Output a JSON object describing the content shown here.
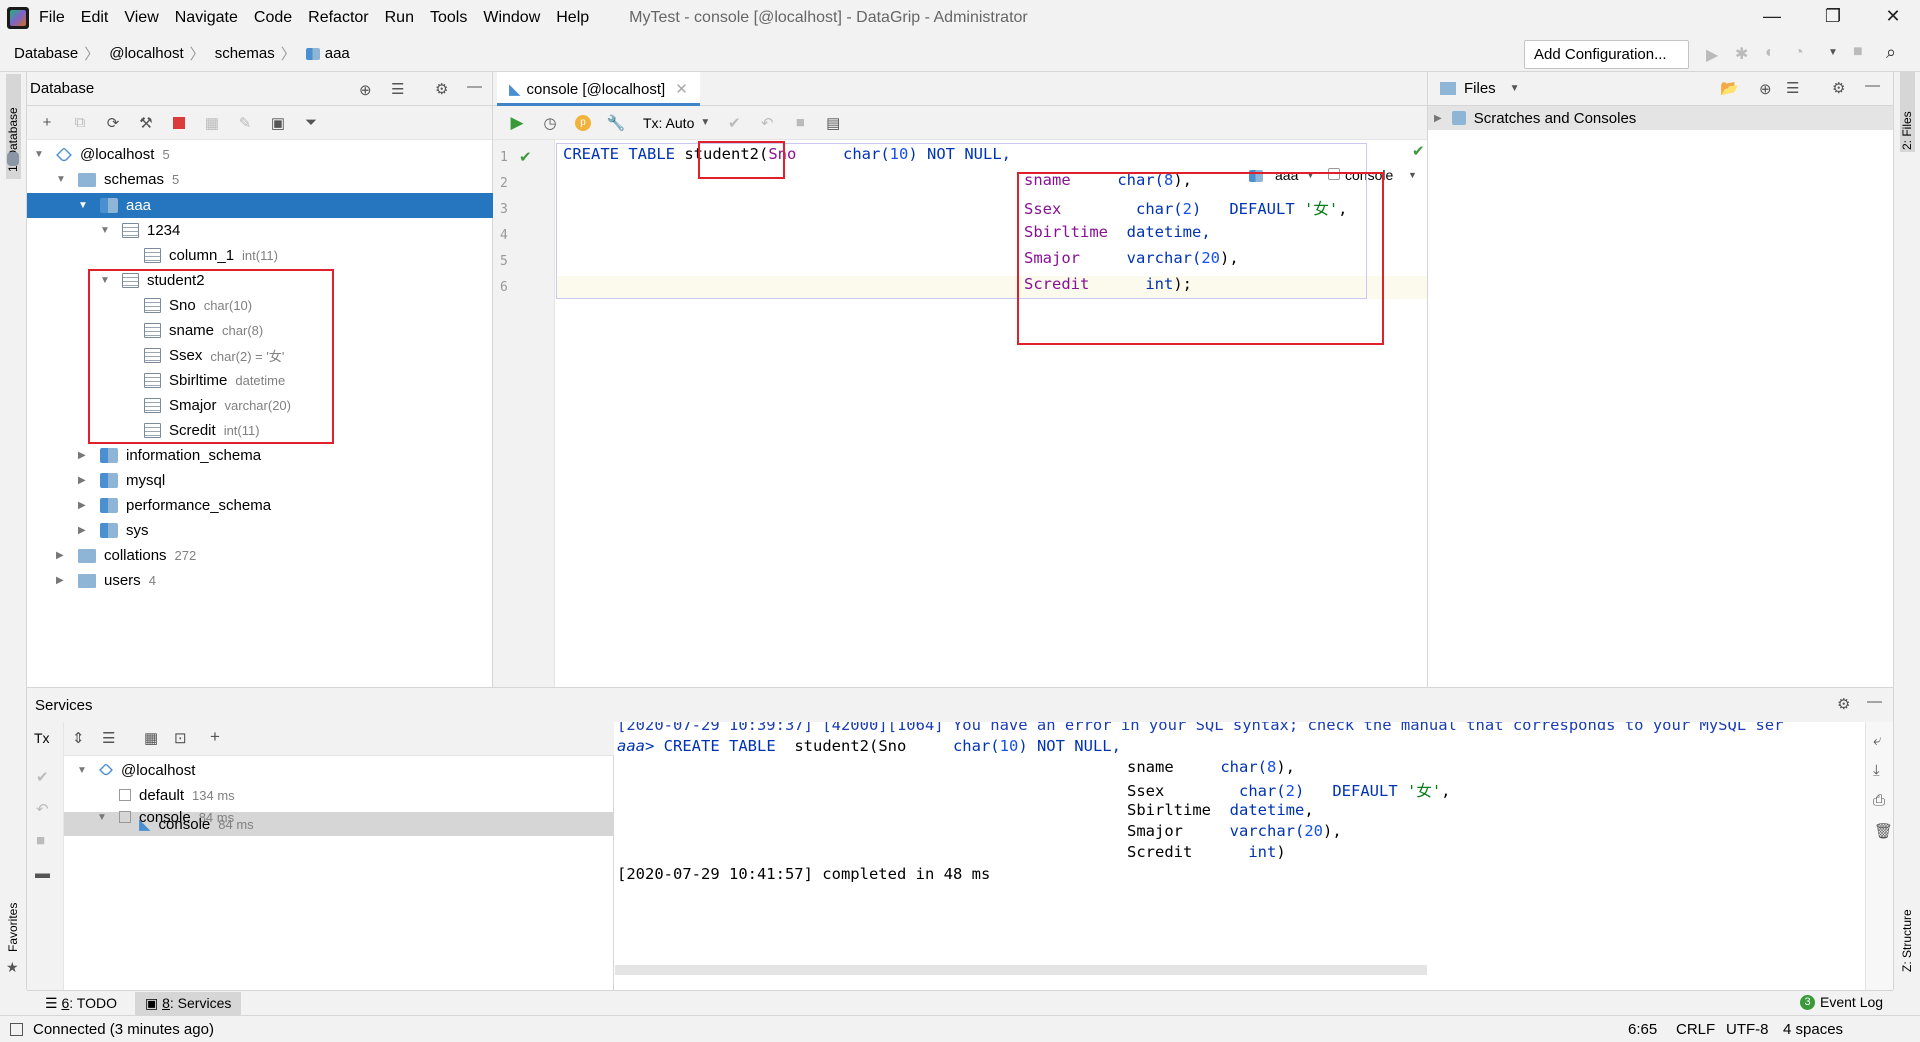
{
  "menu": {
    "items": [
      "File",
      "Edit",
      "View",
      "Navigate",
      "Code",
      "Refactor",
      "Run",
      "Tools",
      "Window",
      "Help"
    ],
    "title": "MyTest - console [@localhost] - DataGrip - Administrator"
  },
  "breadcrumb": [
    "Database",
    "@localhost",
    "schemas",
    "aaa"
  ],
  "add_configuration": "Add Configuration...",
  "left_tabs": {
    "database": "1: Database",
    "favorites": "Favorites"
  },
  "right_tabs": {
    "files": "2: Files",
    "structure": "Z: Structure"
  },
  "database_panel": {
    "title": "Database",
    "tree": [
      {
        "label": "@localhost",
        "sub": "5"
      },
      {
        "label": "schemas",
        "sub": "5"
      },
      {
        "label": "aaa",
        "sub": ""
      },
      {
        "label": "1234",
        "sub": ""
      },
      {
        "label": "column_1",
        "sub": "int(11)"
      },
      {
        "label": "student2",
        "sub": ""
      },
      {
        "label": "Sno",
        "sub": "char(10)"
      },
      {
        "label": "sname",
        "sub": "char(8)"
      },
      {
        "label": "Ssex",
        "sub": "char(2) = '女'"
      },
      {
        "label": "Sbirltime",
        "sub": "datetime"
      },
      {
        "label": "Smajor",
        "sub": "varchar(20)"
      },
      {
        "label": "Scredit",
        "sub": "int(11)"
      },
      {
        "label": "information_schema",
        "sub": ""
      },
      {
        "label": "mysql",
        "sub": ""
      },
      {
        "label": "performance_schema",
        "sub": ""
      },
      {
        "label": "sys",
        "sub": ""
      },
      {
        "label": "collations",
        "sub": "272"
      },
      {
        "label": "users",
        "sub": "4"
      }
    ]
  },
  "editor": {
    "tab": "console [@localhost]",
    "tx": "Tx: Auto",
    "schema": "aaa",
    "session": "console",
    "line_numbers": [
      "1",
      "2",
      "3",
      "4",
      "5",
      "6"
    ],
    "lines": {
      "l1a": "CREATE TABLE ",
      "l1b": "student2",
      "l1c": "(",
      "l1d": "Sno",
      "l1e": "     char(",
      "l1f": "10",
      "l1g": ") NOT NULL,",
      "l2a": "sname",
      "l2b": "     char(",
      "l2c": "8",
      "l2d": "),",
      "l3a": "Ssex",
      "l3b": "        char(",
      "l3c": "2",
      "l3d": ")   DEFAULT ",
      "l3e": "'女'",
      "l3f": ",",
      "l4a": "Sbirltime",
      "l4b": "  datetime,",
      "l5a": "Smajor",
      "l5b": "     varchar(",
      "l5c": "20",
      "l5d": "),",
      "l6a": "Scredit",
      "l6b": "      int",
      "l6c": ");"
    }
  },
  "files_panel": {
    "title": "Files",
    "item": "Scratches and Consoles"
  },
  "services": {
    "title": "Services",
    "tree": [
      {
        "label": "@localhost",
        "sub": ""
      },
      {
        "label": "default",
        "sub": "134 ms"
      },
      {
        "label": "console",
        "sub": "84 ms"
      },
      {
        "label": "console",
        "sub": "84 ms"
      }
    ],
    "output": {
      "error": "[2020-07-29 10:39:37] [42000][1064] You have an error in your SQL syntax; check the manual that corresponds to your MySQL ser",
      "prompt": "aaa> ",
      "o1a": "CREATE TABLE  ",
      "o1b": "student2(Sno     ",
      "o1c": "char(",
      "o1d": "10",
      "o1e": ") NOT NULL,",
      "o2a": "sname     ",
      "o2b": "char(",
      "o2c": "8",
      "o2d": "),",
      "o3a": "Ssex        ",
      "o3b": "char(",
      "o3c": "2",
      "o3d": ")   DEFAULT ",
      "o3e": "'女'",
      "o3f": ",",
      "o4a": "Sbirltime  ",
      "o4b": "datetime",
      "o4c": ",",
      "o5a": "Smajor     ",
      "o5b": "varchar(",
      "o5c": "20",
      "o5d": "),",
      "o6a": "Scredit      ",
      "o6b": "int",
      "o6c": ")",
      "done": "[2020-07-29 10:41:57] completed in 48 ms"
    }
  },
  "bottom_tabs": {
    "todo_num": "6",
    "todo": ": TODO",
    "services_num": "8",
    "services": ": Services",
    "event_count": "3",
    "event_log": "Event Log"
  },
  "status": {
    "connection": "Connected (3 minutes ago)",
    "position": "6:65",
    "line_sep": "CRLF",
    "encoding": "UTF-8",
    "indent": "4 spaces"
  },
  "colors": {
    "accent": "#2675bf",
    "highlight": "#e0202a",
    "keyword": "#0033b3",
    "identifier": "#871094",
    "string": "#067d17",
    "number": "#1750eb"
  }
}
